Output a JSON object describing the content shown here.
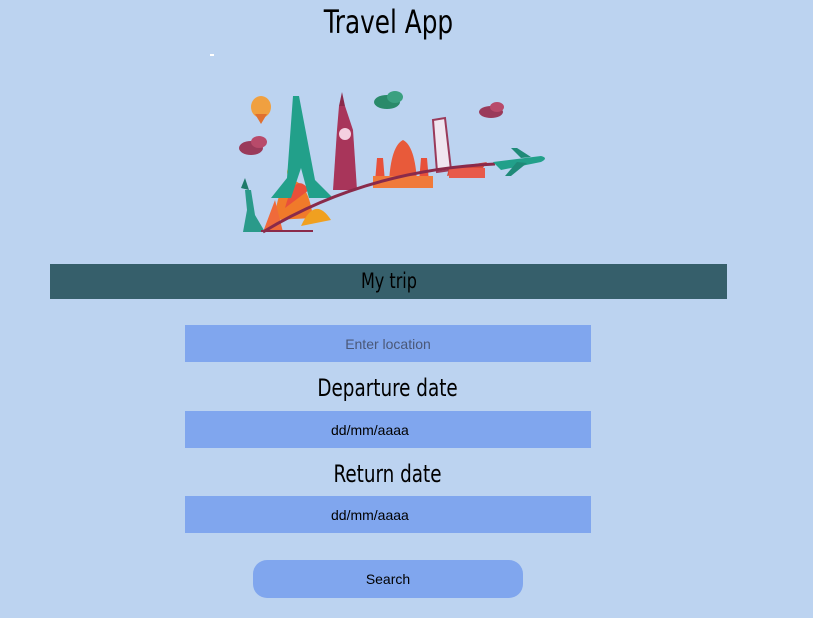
{
  "app": {
    "title": "Travel App"
  },
  "hero": {
    "icon": "travel-landmarks-illustration"
  },
  "trip": {
    "header": "My trip",
    "location_placeholder": "Enter location",
    "departure_label": "Departure date",
    "departure_value": "dd/mm/aaaa",
    "return_label": "Return date",
    "return_value": "dd/mm/aaaa",
    "search_label": "Search"
  },
  "colors": {
    "background": "#bcd3f0",
    "header_bar": "#365f6b",
    "input_fill": "#80a6ee"
  }
}
